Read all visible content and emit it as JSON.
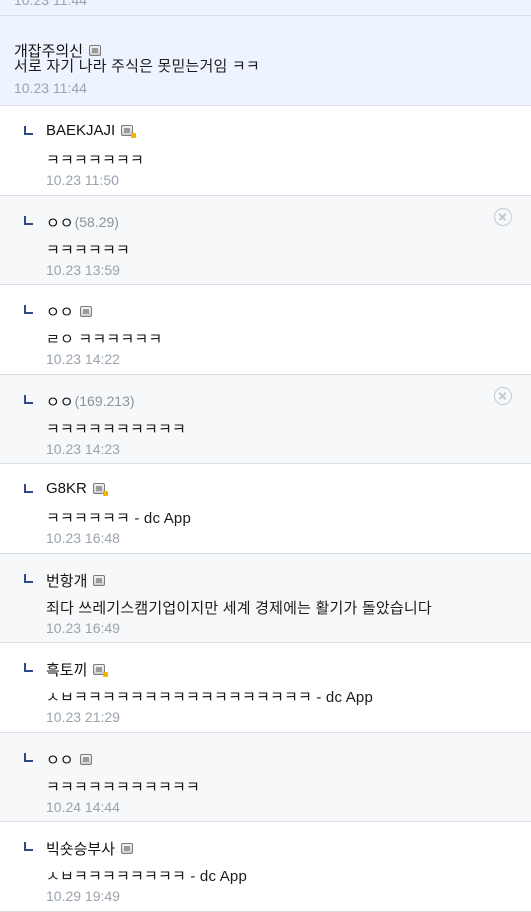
{
  "top_partial_timestamp": "10.23 11:44",
  "main_comment": {
    "author": "개잡주의신",
    "text": "서로 자기 나라 주식은 못믿는거임 ㅋㅋ",
    "timestamp": "10.23 11:44"
  },
  "replies": [
    {
      "author": "BAEKJAJI",
      "ip": "",
      "icon": "gallog-icon-gold",
      "text": "ㅋㅋㅋㅋㅋㅋㅋ",
      "timestamp": "10.23 11:50",
      "deletable": false
    },
    {
      "author": "ㅇㅇ",
      "ip": "(58.29)",
      "icon": "",
      "text": "ㅋㅋㅋㅋㅋㅋ",
      "timestamp": "10.23 13:59",
      "deletable": true
    },
    {
      "author": "ㅇㅇ",
      "ip": "",
      "icon": "gallog-icon",
      "text": "ㄹㅇ ㅋㅋㅋㅋㅋㅋ",
      "timestamp": "10.23 14:22",
      "deletable": false
    },
    {
      "author": "ㅇㅇ",
      "ip": "(169.213)",
      "icon": "",
      "text": "ㅋㅋㅋㅋㅋㅋㅋㅋㅋㅋ",
      "timestamp": "10.23 14:23",
      "deletable": true
    },
    {
      "author": "G8KR",
      "ip": "",
      "icon": "gallog-icon-gold",
      "text": "ㅋㅋㅋㅋㅋㅋ - dc App",
      "timestamp": "10.23 16:48",
      "deletable": false
    },
    {
      "author": "번항개",
      "ip": "",
      "icon": "gallog-icon",
      "text": "죄다 쓰레기스캠기업이지만 세계 경제에는 활기가 돌았습니다",
      "timestamp": "10.23 16:49",
      "deletable": false
    },
    {
      "author": "흑토끼",
      "ip": "",
      "icon": "gallog-icon-gold",
      "text": "ㅅㅂㅋㅋㅋㅋㅋㅋㅋㅋㅋㅋㅋㅋㅋㅋㅋㅋㅋ - dc App",
      "timestamp": "10.23 21:29",
      "deletable": false
    },
    {
      "author": "ㅇㅇ",
      "ip": "",
      "icon": "gallog-icon",
      "text": "ㅋㅋㅋㅋㅋㅋㅋㅋㅋㅋㅋ",
      "timestamp": "10.24 14:44",
      "deletable": false
    },
    {
      "author": "빅숏승부사",
      "ip": "",
      "icon": "gallog-icon",
      "text": "ㅅㅂㅋㅋㅋㅋㅋㅋㅋㅋ - dc App",
      "timestamp": "10.29 19:49",
      "deletable": false
    }
  ]
}
